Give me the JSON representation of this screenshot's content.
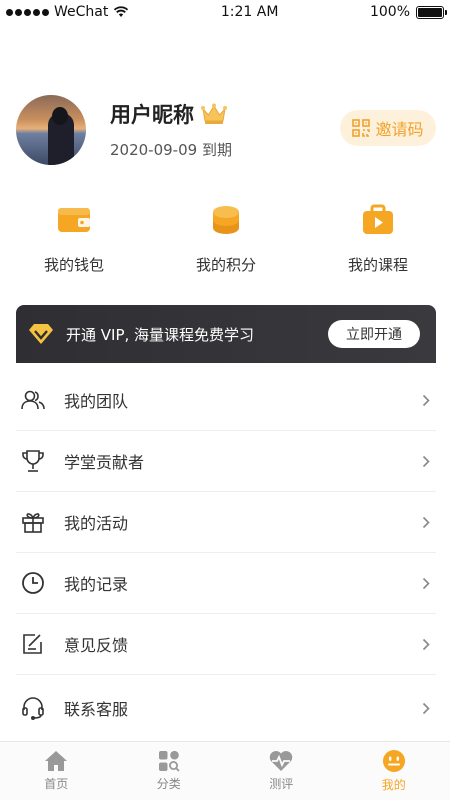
{
  "status_bar": {
    "carrier": "WeChat",
    "time": "1:21 AM",
    "battery": "100%"
  },
  "profile": {
    "nickname": "用户昵称",
    "expiry": "2020-09-09 到期",
    "invite_label": "邀请码"
  },
  "quick_actions": [
    {
      "label": "我的钱包",
      "icon": "wallet-icon"
    },
    {
      "label": "我的积分",
      "icon": "coins-icon"
    },
    {
      "label": "我的课程",
      "icon": "course-icon"
    }
  ],
  "vip": {
    "text": "开通 VIP, 海量课程免费学习",
    "button": "立即开通"
  },
  "menu": [
    {
      "label": "我的团队",
      "icon": "team-icon"
    },
    {
      "label": "学堂贡献者",
      "icon": "trophy-icon"
    },
    {
      "label": "我的活动",
      "icon": "gift-icon"
    },
    {
      "label": "我的记录",
      "icon": "clock-icon"
    },
    {
      "label": "意见反馈",
      "icon": "feedback-icon"
    },
    {
      "label": "联系客服",
      "icon": "headset-icon"
    }
  ],
  "tabs": [
    {
      "label": "首页",
      "icon": "home-icon",
      "active": false
    },
    {
      "label": "分类",
      "icon": "category-icon",
      "active": false
    },
    {
      "label": "测评",
      "icon": "heart-pulse-icon",
      "active": false
    },
    {
      "label": "我的",
      "icon": "smile-face-icon",
      "active": true
    }
  ],
  "colors": {
    "accent": "#f5a623",
    "vip_bg": "#333336",
    "invite_bg": "#fdf1dc"
  }
}
